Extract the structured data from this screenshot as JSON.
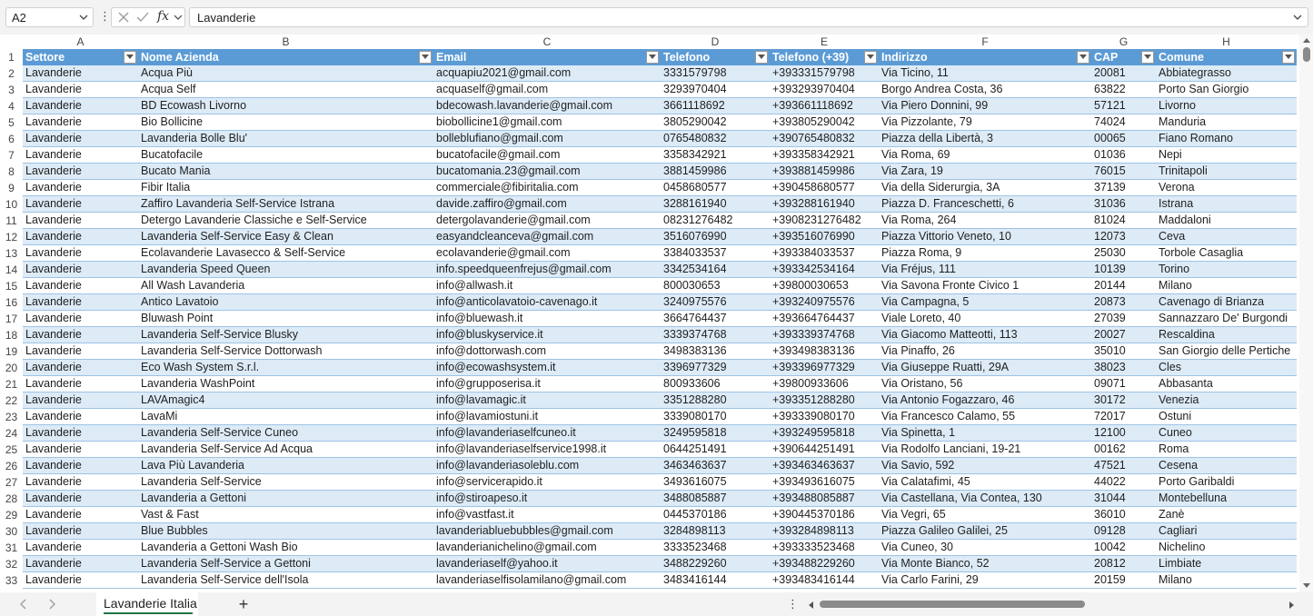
{
  "formula_bar": {
    "name_box": "A2",
    "fx_label": "fx",
    "content": "Lavanderie"
  },
  "columns": [
    "A",
    "B",
    "C",
    "D",
    "E",
    "F",
    "G",
    "H"
  ],
  "headers": [
    "Settore",
    "Nome Azienda",
    "Email",
    "Telefono",
    "Telefono (+39)",
    "Indirizzo",
    "CAP",
    "Comune"
  ],
  "row_numbers": [
    "1",
    "2",
    "3",
    "4",
    "5",
    "6",
    "7",
    "8",
    "9",
    "10",
    "11",
    "12",
    "13",
    "14",
    "15",
    "16",
    "17",
    "18",
    "19",
    "20",
    "21",
    "22",
    "23",
    "24",
    "25",
    "26",
    "27",
    "28",
    "29",
    "30",
    "31",
    "32",
    "33"
  ],
  "rows": [
    [
      "Lavanderie",
      "Acqua Più",
      "acquapiu2021@gmail.com",
      "3331579798",
      "+393331579798",
      "Via Ticino, 11",
      "20081",
      "Abbiategrasso"
    ],
    [
      "Lavanderie",
      "Acqua Self",
      "acquaself@gmail.com",
      "3293970404",
      "+393293970404",
      "Borgo Andrea Costa, 36",
      "63822",
      "Porto San Giorgio"
    ],
    [
      "Lavanderie",
      "BD Ecowash Livorno",
      "bdecowash.lavanderie@gmail.com",
      "3661118692",
      "+393661118692",
      "Via Piero Donnini, 99",
      "57121",
      "Livorno"
    ],
    [
      "Lavanderie",
      "Bio Bollicine",
      "biobollicine1@gmail.com",
      "3805290042",
      "+393805290042",
      "Via Pizzolante, 79",
      "74024",
      "Manduria"
    ],
    [
      "Lavanderie",
      "Lavanderia Bolle Blu'",
      "bolleblufiano@gmail.com",
      "0765480832",
      "+390765480832",
      "Piazza della Libertà, 3",
      "00065",
      "Fiano Romano"
    ],
    [
      "Lavanderie",
      "Bucatofacile",
      "bucatofacile@gmail.com",
      "3358342921",
      "+393358342921",
      "Via Roma, 69",
      "01036",
      "Nepi"
    ],
    [
      "Lavanderie",
      "Bucato Mania",
      "bucatomania.23@gmail.com",
      "3881459986",
      "+393881459986",
      "Via Zara, 19",
      "76015",
      "Trinitapoli"
    ],
    [
      "Lavanderie",
      "Fibir Italia",
      "commerciale@fibiritalia.com",
      "0458680577",
      "+390458680577",
      "Via della Siderurgia, 3A",
      "37139",
      "Verona"
    ],
    [
      "Lavanderie",
      "Zaffiro Lavanderia Self-Service Istrana",
      "davide.zaffiro@gmail.com",
      "3288161940",
      "+393288161940",
      "Piazza D. Franceschetti, 6",
      "31036",
      "Istrana"
    ],
    [
      "Lavanderie",
      "Detergo Lavanderie Classiche e Self-Service",
      "detergolavanderie@gmail.com",
      "08231276482",
      "+3908231276482",
      "Via Roma, 264",
      "81024",
      "Maddaloni"
    ],
    [
      "Lavanderie",
      "Lavanderia Self-Service Easy & Clean",
      "easyandcleanceva@gmail.com",
      "3516076990",
      "+393516076990",
      "Piazza Vittorio Veneto, 10",
      "12073",
      "Ceva"
    ],
    [
      "Lavanderie",
      "Ecolavanderie Lavasecco & Self-Service",
      "ecolavanderie@gmail.com",
      "3384033537",
      "+393384033537",
      "Piazza Roma, 9",
      "25030",
      "Torbole Casaglia"
    ],
    [
      "Lavanderie",
      "Lavanderia Speed Queen",
      "info.speedqueenfrejus@gmail.com",
      "3342534164",
      "+393342534164",
      "Via Fréjus, 111",
      "10139",
      "Torino"
    ],
    [
      "Lavanderie",
      "All Wash Lavanderia",
      "info@allwash.it",
      "800030653",
      "+39800030653",
      "Via Savona Fronte Civico 1",
      "20144",
      "Milano"
    ],
    [
      "Lavanderie",
      "Antico Lavatoio",
      "info@anticolavatoio-cavenago.it",
      "3240975576",
      "+393240975576",
      "Via Campagna, 5",
      "20873",
      "Cavenago di Brianza"
    ],
    [
      "Lavanderie",
      "Bluwash Point",
      "info@bluewash.it",
      "3664764437",
      "+393664764437",
      "Viale Loreto, 40",
      "27039",
      "Sannazzaro De' Burgondi"
    ],
    [
      "Lavanderie",
      "Lavanderia Self-Service Blusky",
      "info@bluskyservice.it",
      "3339374768",
      "+393339374768",
      "Via Giacomo Matteotti, 113",
      "20027",
      "Rescaldina"
    ],
    [
      "Lavanderie",
      "Lavanderia Self-Service Dottorwash",
      "info@dottorwash.com",
      "3498383136",
      "+393498383136",
      "Via Pinaffo, 26",
      "35010",
      "San Giorgio delle Pertiche"
    ],
    [
      "Lavanderie",
      "Eco Wash System S.r.l.",
      "info@ecowashsystem.it",
      "3396977329",
      "+393396977329",
      "Via Giuseppe Ruatti, 29A",
      "38023",
      "Cles"
    ],
    [
      "Lavanderie",
      "Lavanderia WashPoint",
      "info@grupposerisa.it",
      "800933606",
      "+39800933606",
      "Via Oristano, 56",
      "09071",
      "Abbasanta"
    ],
    [
      "Lavanderie",
      "LAVAmagic4",
      "info@lavamagic.it",
      "3351288280",
      "+393351288280",
      "Via Antonio Fogazzaro, 46",
      "30172",
      "Venezia"
    ],
    [
      "Lavanderie",
      "LavaMi",
      "info@lavamiostuni.it",
      "3339080170",
      "+393339080170",
      "Via Francesco Calamo, 55",
      "72017",
      "Ostuni"
    ],
    [
      "Lavanderie",
      "Lavanderia Self-Service Cuneo",
      "info@lavanderiaselfcuneo.it",
      "3249595818",
      "+393249595818",
      "Via Spinetta, 1",
      "12100",
      "Cuneo"
    ],
    [
      "Lavanderie",
      "Lavanderia Self-Service Ad Acqua",
      "info@lavanderiaselfservice1998.it",
      "0644251491",
      "+390644251491",
      "Via Rodolfo Lanciani, 19-21",
      "00162",
      "Roma"
    ],
    [
      "Lavanderie",
      "Lava Più Lavanderia",
      "info@lavanderiasoleblu.com",
      "3463463637",
      "+393463463637",
      "Via Savio, 592",
      "47521",
      "Cesena"
    ],
    [
      "Lavanderie",
      "Lavanderia Self-Service",
      "info@servicerapido.it",
      "3493616075",
      "+393493616075",
      "Via Calatafimi, 45",
      "44022",
      "Porto Garibaldi"
    ],
    [
      "Lavanderie",
      "Lavanderia a Gettoni",
      "info@stiroapeso.it",
      "3488085887",
      "+393488085887",
      "Via Castellana, Via Contea, 130",
      "31044",
      "Montebelluna"
    ],
    [
      "Lavanderie",
      "Vast & Fast",
      "info@vastfast.it",
      "0445370186",
      "+390445370186",
      "Via Vegri, 65",
      "36010",
      "Zanè"
    ],
    [
      "Lavanderie",
      "Blue Bubbles",
      "lavanderiabluebubbles@gmail.com",
      "3284898113",
      "+393284898113",
      "Piazza Galileo Galilei, 25",
      "09128",
      "Cagliari"
    ],
    [
      "Lavanderie",
      "Lavanderia a Gettoni Wash Bio",
      "lavanderianichelino@gmail.com",
      "3333523468",
      "+393333523468",
      "Via Cuneo, 30",
      "10042",
      "Nichelino"
    ],
    [
      "Lavanderie",
      "Lavanderia Self-Service a Gettoni",
      "lavanderiaself@yahoo.it",
      "3488229260",
      "+393488229260",
      "Via Monte Bianco, 52",
      "20812",
      "Limbiate"
    ],
    [
      "Lavanderie",
      "Lavanderia Self-Service dell'Isola",
      "lavanderiaselfisolamilano@gmail.com",
      "3483416144",
      "+393483416144",
      "Via Carlo Farini, 29",
      "20159",
      "Milano"
    ]
  ],
  "sheet_tab": "Lavanderie Italia",
  "add_sheet": "+",
  "colors": {
    "header_bg": "#5b9bd5",
    "band": "#ddebf7",
    "tab_accent": "#217346"
  }
}
